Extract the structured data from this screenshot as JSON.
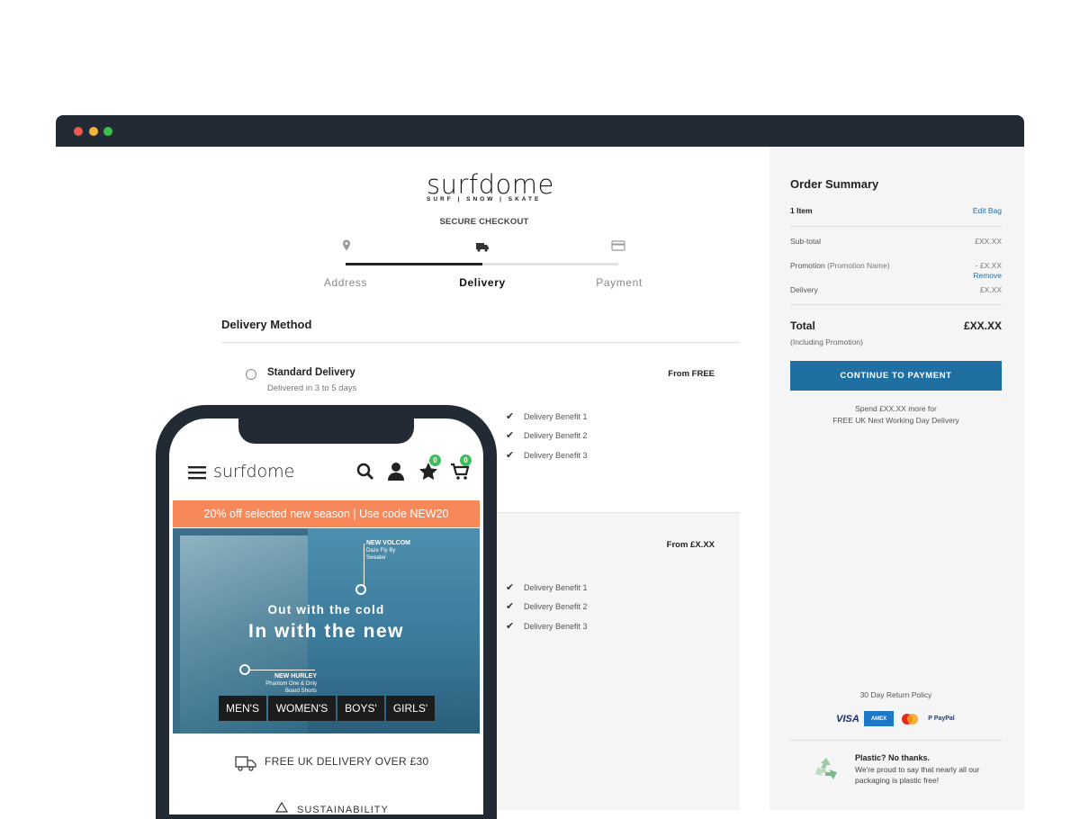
{
  "checkout": {
    "logo": "surfdome",
    "logo_tagline": "SURF | SNOW | SKATE",
    "secure_label": "SECURE CHECKOUT",
    "progress_fraction": 0.5,
    "steps": [
      {
        "label": "Address",
        "icon": "map-pin-icon"
      },
      {
        "label": "Delivery",
        "icon": "truck-icon"
      },
      {
        "label": "Payment",
        "icon": "credit-card-icon"
      }
    ],
    "section_title": "Delivery Method",
    "options": [
      {
        "name": "Standard Delivery",
        "sub": "Delivered in 3 to 5 days",
        "price": "From FREE",
        "benefits": [
          "Delivery Benefit 1",
          "Delivery Benefit 2",
          "Delivery Benefit 3"
        ]
      },
      {
        "price": "From £X.XX",
        "benefits": [
          "Delivery Benefit 1",
          "Delivery Benefit 2",
          "Delivery Benefit 3"
        ]
      }
    ]
  },
  "summary": {
    "title": "Order Summary",
    "items": "1 Item",
    "edit_bag": "Edit Bag",
    "subtotal_label": "Sub-total",
    "subtotal_value": "£XX.XX",
    "promotion_label": "Promotion",
    "promotion_name": "(Promotion Name)",
    "promotion_value": "- £X.XX",
    "remove": "Remove",
    "delivery_label": "Delivery",
    "delivery_value": "£X.XX",
    "total_label": "Total",
    "total_value": "£XX.XX",
    "total_note": "(Including Promotion)",
    "cta": "CONTINUE TO PAYMENT",
    "spend_line1": "Spend £XX.XX more for",
    "spend_line2": "FREE UK Next Working Day Delivery",
    "returns": "30 Day Return Policy",
    "payments": [
      "VISA",
      "AMEX",
      "Mastercard",
      "P PayPal"
    ],
    "plastic_title": "Plastic? No thanks.",
    "plastic_text": "We're proud to say that nearly all our packaging is plastic free!"
  },
  "mobile": {
    "logo": "surfdome",
    "wishlist_count": "0",
    "cart_count": "0",
    "promo": "20% off selected new season | Use code NEW20",
    "hero_line1": "Out with the cold",
    "hero_line2": "In with the new",
    "tag_top_title": "NEW VOLCOM",
    "tag_top_sub1": "Daze Fly By",
    "tag_top_sub2": "Sweater",
    "tag_bottom_title": "NEW HURLEY",
    "tag_bottom_sub1": "Phantom One & Only",
    "tag_bottom_sub2": "Board Shorts",
    "categories": [
      "MEN'S",
      "WOMEN'S",
      "BOYS'",
      "GIRLS'"
    ],
    "free_delivery": "FREE UK DELIVERY OVER £30",
    "sustainability": "SUSTAINABILITY"
  }
}
